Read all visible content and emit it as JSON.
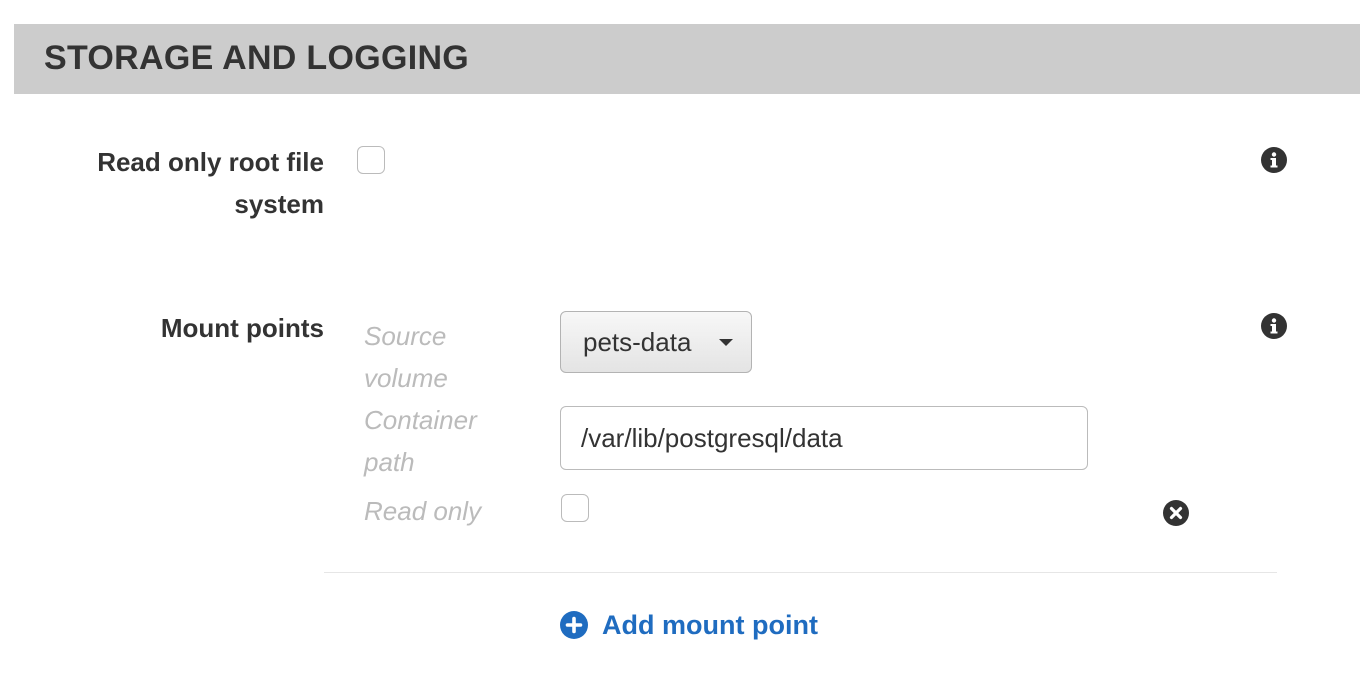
{
  "section": {
    "title": "STORAGE AND LOGGING"
  },
  "readonly_root": {
    "label_line1": "Read only root file",
    "label_line2": "system",
    "checked": false
  },
  "mount_points": {
    "label": "Mount points",
    "source_volume_label_line1": "Source",
    "source_volume_label_line2": "volume",
    "source_volume_value": "pets-data",
    "container_path_label_line1": "Container",
    "container_path_label_line2": "path",
    "container_path_value": "/var/lib/postgresql/data",
    "read_only_label": "Read only",
    "read_only_checked": false,
    "add_label": "Add mount point"
  },
  "icons": {
    "info": "info-icon",
    "remove": "close-circle-icon",
    "add": "plus-circle-icon",
    "dropdown": "caret-down-icon"
  },
  "colors": {
    "header_bg": "#cccccc",
    "link": "#1f6cc0",
    "muted_label": "#bbbbbb",
    "text": "#333333"
  }
}
